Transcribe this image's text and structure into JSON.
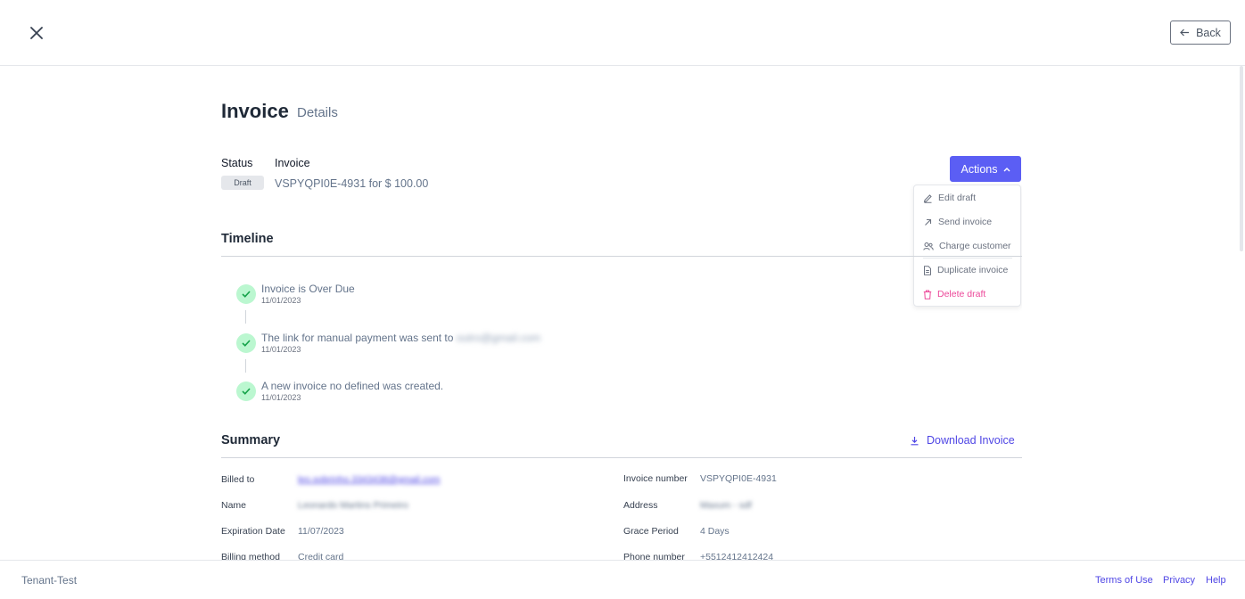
{
  "header": {
    "back_label": "Back"
  },
  "page": {
    "title": "Invoice",
    "subtitle": "Details"
  },
  "status": {
    "label": "Status",
    "badge": "Draft"
  },
  "invoice": {
    "label": "Invoice",
    "summary": "VSPYQPI0E-4931 for $ 100.00"
  },
  "actions": {
    "label": "Actions",
    "menu": [
      {
        "label": "Edit draft",
        "icon": "pencil-icon"
      },
      {
        "label": "Send invoice",
        "icon": "arrow-up-right-icon"
      },
      {
        "label": "Charge customer",
        "icon": "users-icon"
      },
      {
        "label": "Duplicate invoice",
        "icon": "document-icon"
      },
      {
        "label": "Delete draft",
        "icon": "trash-icon"
      }
    ]
  },
  "timeline": {
    "title": "Timeline",
    "events": [
      {
        "text": "Invoice is Over Due",
        "date": "11/01/2023"
      },
      {
        "text": "The link for manual payment was sent to",
        "email": "outro@gmail.com",
        "date": "11/01/2023"
      },
      {
        "text": "A new invoice no defined was created.",
        "date": "11/01/2023"
      }
    ]
  },
  "summary": {
    "title": "Summary",
    "download_label": "Download Invoice",
    "left": [
      {
        "label": "Billed to",
        "value": "leo.sobrinho.3343438@gmail.com"
      },
      {
        "label": "Name",
        "value": "Leonardo Martins Primeiro"
      },
      {
        "label": "Expiration Date",
        "value": "11/07/2023"
      },
      {
        "label": "Billing method",
        "value": "Credit card"
      }
    ],
    "right": [
      {
        "label": "Invoice number",
        "value": "VSPYQPI0E-4931"
      },
      {
        "label": "Address",
        "value": "Maxum - sdf"
      },
      {
        "label": "Grace Period",
        "value": "4 Days"
      },
      {
        "label": "Phone number",
        "value": "+5512412412424"
      }
    ]
  },
  "footer": {
    "tenant": "Tenant-Test",
    "links": [
      "Terms of Use",
      "Privacy",
      "Help"
    ]
  },
  "colors": {
    "accent": "#5b5ef4",
    "success_bg": "#bbf7d0",
    "success": "#16a34a",
    "danger": "#ec4899"
  }
}
